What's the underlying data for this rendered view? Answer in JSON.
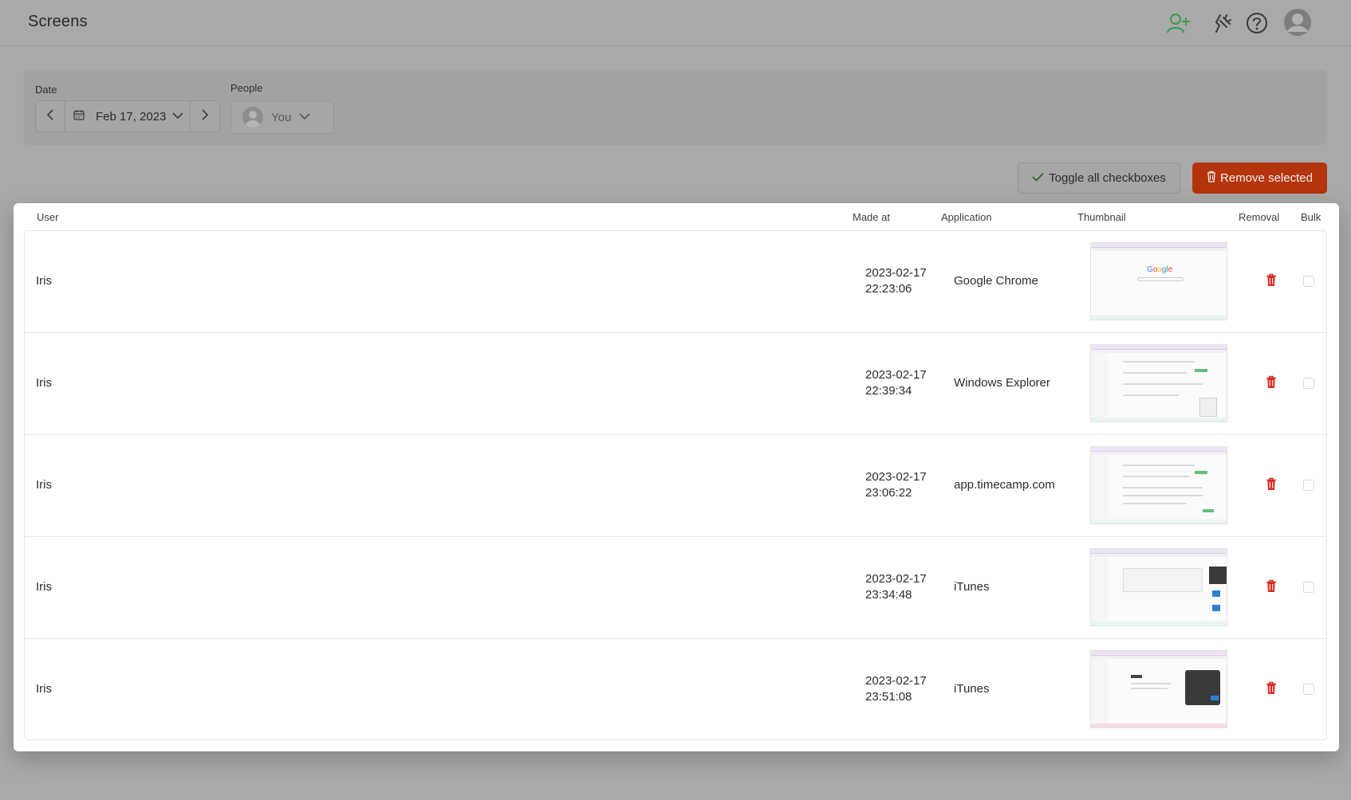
{
  "header": {
    "title": "Screens",
    "icons": [
      "add-user-icon",
      "plugin-icon",
      "help-icon",
      "user-avatar-icon"
    ]
  },
  "filters": {
    "date_label": "Date",
    "date_value": "Feb 17, 2023",
    "people_label": "People",
    "people_value": "You"
  },
  "actions": {
    "toggle_label": "Toggle all checkboxes",
    "remove_label": "Remove selected"
  },
  "table": {
    "columns": {
      "user": "User",
      "made_at": "Made at",
      "application": "Application",
      "thumbnail": "Thumbnail",
      "removal": "Removal",
      "bulk": "Bulk"
    },
    "rows": [
      {
        "user": "Iris",
        "date": "2023-02-17",
        "time": "22:23:06",
        "application": "Google Chrome",
        "thumb": "google"
      },
      {
        "user": "Iris",
        "date": "2023-02-17",
        "time": "22:39:34",
        "application": "Windows Explorer",
        "thumb": "form"
      },
      {
        "user": "Iris",
        "date": "2023-02-17",
        "time": "23:06:22",
        "application": "app.timecamp.com",
        "thumb": "form"
      },
      {
        "user": "Iris",
        "date": "2023-02-17",
        "time": "23:34:48",
        "application": "iTunes",
        "thumb": "media"
      },
      {
        "user": "Iris",
        "date": "2023-02-17",
        "time": "23:51:08",
        "application": "iTunes",
        "thumb": "music"
      }
    ],
    "google_text": "Google"
  },
  "colors": {
    "accent_green": "#3e9a52",
    "danger": "#b4340c",
    "trash_red": "#d92b22"
  }
}
